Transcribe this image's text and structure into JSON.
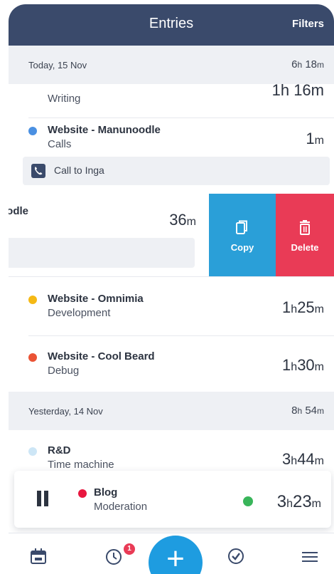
{
  "header": {
    "title": "Entries",
    "filters_label": "Filters"
  },
  "days": [
    {
      "date": "Today, 15 Nov",
      "total_hours": "6",
      "total_h_unit": "h",
      "total_minutes": "18",
      "total_m_unit": "m"
    },
    {
      "date": "Yesterday, 14 Nov",
      "total_hours": "8",
      "total_h_unit": "h",
      "total_minutes": "54",
      "total_m_unit": "m"
    }
  ],
  "entries": [
    {
      "subtitle": "Writing",
      "duration": "1h 16m"
    },
    {
      "title": "Website - Manunoodle",
      "subtitle": "Calls",
      "duration_value": "1",
      "duration_unit": "m",
      "color": "#4a90e2",
      "note": {
        "icon": "phone-icon",
        "text": "Call to Inga"
      }
    },
    {
      "title": "oodle",
      "duration_value": "36",
      "duration_unit": "m"
    },
    {
      "title": "Website - Omnimia",
      "subtitle": "Development",
      "h": "1",
      "m": "25",
      "color": "#f5b915"
    },
    {
      "title": "Website - Cool Beard",
      "subtitle": "Debug",
      "h": "1",
      "m": "30",
      "color": "#ea5335"
    },
    {
      "title": "R&D",
      "subtitle": "Time machine",
      "h": "3",
      "m": "44",
      "color": "#cde6f6"
    }
  ],
  "swipe_actions": {
    "copy_label": "Copy",
    "delete_label": "Delete",
    "copy_color": "#2a9fd8",
    "delete_color": "#e93b56"
  },
  "running_timer": {
    "title": "Blog",
    "subtitle": "Moderation",
    "h": "3",
    "m": "23",
    "color": "#e8173f",
    "status_color": "#39b55a"
  },
  "tabbar": {
    "items": [
      "calendar-icon",
      "timer-icon",
      "add-icon",
      "checkmark-icon",
      "menu-icon"
    ],
    "timer_badge": "1",
    "fab_symbol": "+"
  },
  "units": {
    "h": "h",
    "m": "m"
  }
}
